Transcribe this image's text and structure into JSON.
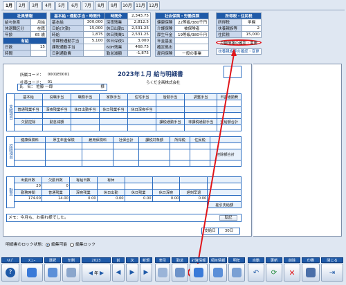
{
  "month_tabs": [
    "1月",
    "2月",
    "3月",
    "4月",
    "5月",
    "6月",
    "7月",
    "8月",
    "9月",
    "10月",
    "11月",
    "12月"
  ],
  "employee_panel": {
    "header": "社員情報",
    "rows": [
      {
        "label": "給与体系",
        "value": "月給"
      },
      {
        "label": "休退職区分",
        "value": "在籍"
      },
      {
        "label": "年齢",
        "value": "65 歳"
      }
    ],
    "kyuka_header": "有給",
    "kyuka_rows": [
      {
        "label": "日数",
        "value": "15"
      },
      {
        "label": "時間",
        "value": ""
      }
    ]
  },
  "salary_panel": {
    "header1": "基本給・通勤手当・時間外",
    "header2": "",
    "rows": [
      {
        "a": "基本給",
        "b": "300,000",
        "c": "深夜残業",
        "d": "2,812.5"
      },
      {
        "a": "日給(欠勤)",
        "b": "15,000",
        "c": "休日出勤1",
        "d": "2,531.25"
      },
      {
        "a": "時給",
        "b": "1,875",
        "c": "休日残業1",
        "d": "2,531.25"
      },
      {
        "a": "非課税通勤手当",
        "b": "5,100",
        "c": "休日深夜1",
        "d": "3,000"
      },
      {
        "a": "課税通勤手当",
        "b": "",
        "c": "60H残業",
        "d": "468.75"
      },
      {
        "a": "日割通勤費",
        "b": "",
        "c": "勤怠減額",
        "d": "-1,875"
      }
    ],
    "top_right_label": "時間外",
    "top_right_value": "2,343.75"
  },
  "insurance_panel": {
    "header": "社会保険・労働保険",
    "rows": [
      {
        "a": "健康保険",
        "b": "22等級/380千円"
      },
      {
        "a": "介護保険",
        "b": "被保険者"
      },
      {
        "a": "厚生年金",
        "b": "19等級/380千円"
      },
      {
        "a": "年金基金",
        "b": ""
      },
      {
        "a": "確定拠出",
        "b": ""
      }
    ],
    "employment_label": "雇用保険",
    "employment_value": "一般の事業"
  },
  "tax_panel": {
    "header": "所得税・住民税",
    "rows": [
      {
        "a": "所得税",
        "b": "甲欄"
      },
      {
        "a": "扶養親族等",
        "b": "2"
      },
      {
        "a": "住民税",
        "b": "15,000"
      }
    ],
    "link1": "月額情報の確認・変更",
    "link2": "扶養親族等の確認・変更"
  },
  "payslip": {
    "code_label": "所属コード：",
    "code_value": "0001E0001",
    "emp_label": "社員コード：",
    "emp_value": "01",
    "name_label": "氏　名：",
    "name_value": "佐藤 一郎",
    "name_suffix": "様",
    "title": "2023年１月 給与明細書",
    "company": "らくだ企画株式会社",
    "pay_section": "支給項目",
    "pay_row1": [
      "基本給",
      "役職手当",
      "職務手当",
      "家族手当",
      "住宅手当",
      "皆勤手当",
      "調整手当",
      "日割通勤費"
    ],
    "pay_row1_vals": [
      "",
      "",
      "",
      "",
      "",
      "",
      "",
      ""
    ],
    "pay_row2": [
      "普通残業手当",
      "深夜残業手当",
      "休日出勤手当",
      "休日残業手当",
      "休日深夜手当",
      "",
      "",
      ""
    ],
    "pay_row3": [
      "欠勤控除",
      "勤怠減額",
      "",
      "",
      "",
      "課税通勤手当",
      "非課税通勤手当",
      "支給額合計"
    ],
    "ded_section": "控除項目",
    "ded_row1": [
      "健康保険料",
      "厚生年金保険",
      "雇用保険料",
      "社保合計",
      "課税対象額",
      "所得税",
      "住民税",
      ""
    ],
    "ded_total": "控除額合計",
    "att_section": "勤怠",
    "att_row1": [
      "出勤日数",
      "欠勤日数",
      "有給日数",
      "有休",
      "",
      "",
      "",
      ""
    ],
    "att_row1_vals": [
      "20",
      "0",
      "",
      "",
      "",
      "",
      "",
      ""
    ],
    "att_row2": [
      "勤務時間",
      "普通残業",
      "深夜残業",
      "休日出勤",
      "休日残業",
      "休日深夜",
      "遅刻早退",
      ""
    ],
    "att_row2_vals": [
      "174.00",
      "14.00",
      "0.00",
      "0.00",
      "0.00",
      "0.00",
      "0.00",
      ""
    ],
    "net_pay": "差引支給額",
    "memo_label": "メモ",
    "memo": "今月も、お疲れ様でした。",
    "memo_button": "転記",
    "date_label": "支給日",
    "date_value": "30日"
  },
  "lock_state": {
    "label": "明細書のロック状態:",
    "opt1": "編集可能",
    "opt2": "編集ロック"
  },
  "toolbar": {
    "groups": [
      "ﾍﾙﾌﾟ",
      "ﾒﾆｭｰ",
      "選択",
      "印刷",
      "年",
      "前",
      "次",
      "新規",
      "表引",
      "勤怠",
      "計算情報",
      "項目情報",
      "明年",
      "自動",
      "更新",
      "削除",
      "印刷",
      "閉じる"
    ],
    "year": "2023"
  }
}
